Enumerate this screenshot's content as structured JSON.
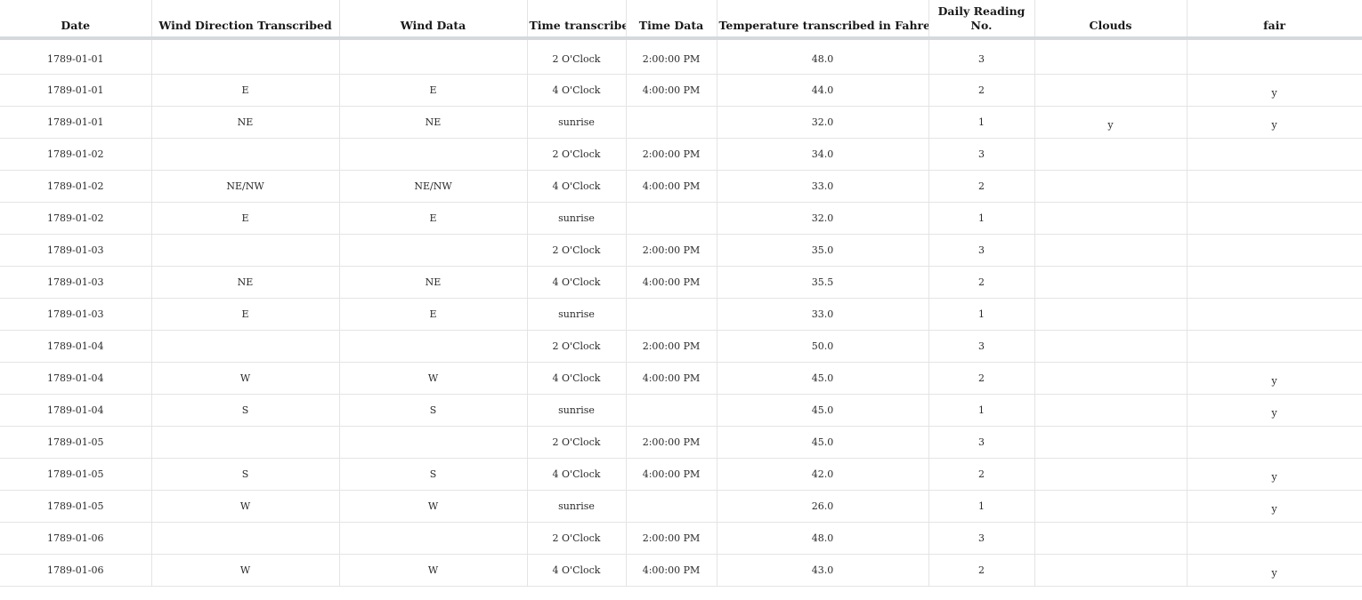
{
  "columns": [
    "Date",
    "Wind Direction Transcribed",
    "Wind Data",
    "Time transcribed",
    "Time Data",
    "Temperature transcribed in Fahrenheit",
    "Daily Reading No.",
    "Clouds",
    "fair"
  ],
  "rows": [
    {
      "date": "1789-01-01",
      "wind_t": "",
      "wind_d": "",
      "time_t": "2 O'Clock",
      "time_d": "2:00:00 PM",
      "temp": "48.0",
      "reading": "3",
      "clouds": "",
      "fair": ""
    },
    {
      "date": "1789-01-01",
      "wind_t": "E",
      "wind_d": "E",
      "time_t": "4 O'Clock",
      "time_d": "4:00:00 PM",
      "temp": "44.0",
      "reading": "2",
      "clouds": "",
      "fair": "y"
    },
    {
      "date": "1789-01-01",
      "wind_t": "NE",
      "wind_d": "NE",
      "time_t": "sunrise",
      "time_d": "",
      "temp": "32.0",
      "reading": "1",
      "clouds": "y",
      "fair": "y"
    },
    {
      "date": "1789-01-02",
      "wind_t": "",
      "wind_d": "",
      "time_t": "2 O'Clock",
      "time_d": "2:00:00 PM",
      "temp": "34.0",
      "reading": "3",
      "clouds": "",
      "fair": ""
    },
    {
      "date": "1789-01-02",
      "wind_t": "NE/NW",
      "wind_d": "NE/NW",
      "time_t": "4 O'Clock",
      "time_d": "4:00:00 PM",
      "temp": "33.0",
      "reading": "2",
      "clouds": "",
      "fair": ""
    },
    {
      "date": "1789-01-02",
      "wind_t": "E",
      "wind_d": "E",
      "time_t": "sunrise",
      "time_d": "",
      "temp": "32.0",
      "reading": "1",
      "clouds": "",
      "fair": ""
    },
    {
      "date": "1789-01-03",
      "wind_t": "",
      "wind_d": "",
      "time_t": "2 O'Clock",
      "time_d": "2:00:00 PM",
      "temp": "35.0",
      "reading": "3",
      "clouds": "",
      "fair": ""
    },
    {
      "date": "1789-01-03",
      "wind_t": "NE",
      "wind_d": "NE",
      "time_t": "4 O'Clock",
      "time_d": "4:00:00 PM",
      "temp": "35.5",
      "reading": "2",
      "clouds": "",
      "fair": ""
    },
    {
      "date": "1789-01-03",
      "wind_t": "E",
      "wind_d": "E",
      "time_t": "sunrise",
      "time_d": "",
      "temp": "33.0",
      "reading": "1",
      "clouds": "",
      "fair": ""
    },
    {
      "date": "1789-01-04",
      "wind_t": "",
      "wind_d": "",
      "time_t": "2 O'Clock",
      "time_d": "2:00:00 PM",
      "temp": "50.0",
      "reading": "3",
      "clouds": "",
      "fair": ""
    },
    {
      "date": "1789-01-04",
      "wind_t": "W",
      "wind_d": "W",
      "time_t": "4 O'Clock",
      "time_d": "4:00:00 PM",
      "temp": "45.0",
      "reading": "2",
      "clouds": "",
      "fair": "y"
    },
    {
      "date": "1789-01-04",
      "wind_t": "S",
      "wind_d": "S",
      "time_t": "sunrise",
      "time_d": "",
      "temp": "45.0",
      "reading": "1",
      "clouds": "",
      "fair": "y"
    },
    {
      "date": "1789-01-05",
      "wind_t": "",
      "wind_d": "",
      "time_t": "2 O'Clock",
      "time_d": "2:00:00 PM",
      "temp": "45.0",
      "reading": "3",
      "clouds": "",
      "fair": ""
    },
    {
      "date": "1789-01-05",
      "wind_t": "S",
      "wind_d": "S",
      "time_t": "4 O'Clock",
      "time_d": "4:00:00 PM",
      "temp": "42.0",
      "reading": "2",
      "clouds": "",
      "fair": "y"
    },
    {
      "date": "1789-01-05",
      "wind_t": "W",
      "wind_d": "W",
      "time_t": "sunrise",
      "time_d": "",
      "temp": "26.0",
      "reading": "1",
      "clouds": "",
      "fair": "y"
    },
    {
      "date": "1789-01-06",
      "wind_t": "",
      "wind_d": "",
      "time_t": "2 O'Clock",
      "time_d": "2:00:00 PM",
      "temp": "48.0",
      "reading": "3",
      "clouds": "",
      "fair": ""
    },
    {
      "date": "1789-01-06",
      "wind_t": "W",
      "wind_d": "W",
      "time_t": "4 O'Clock",
      "time_d": "4:00:00 PM",
      "temp": "43.0",
      "reading": "2",
      "clouds": "",
      "fair": "y"
    }
  ]
}
